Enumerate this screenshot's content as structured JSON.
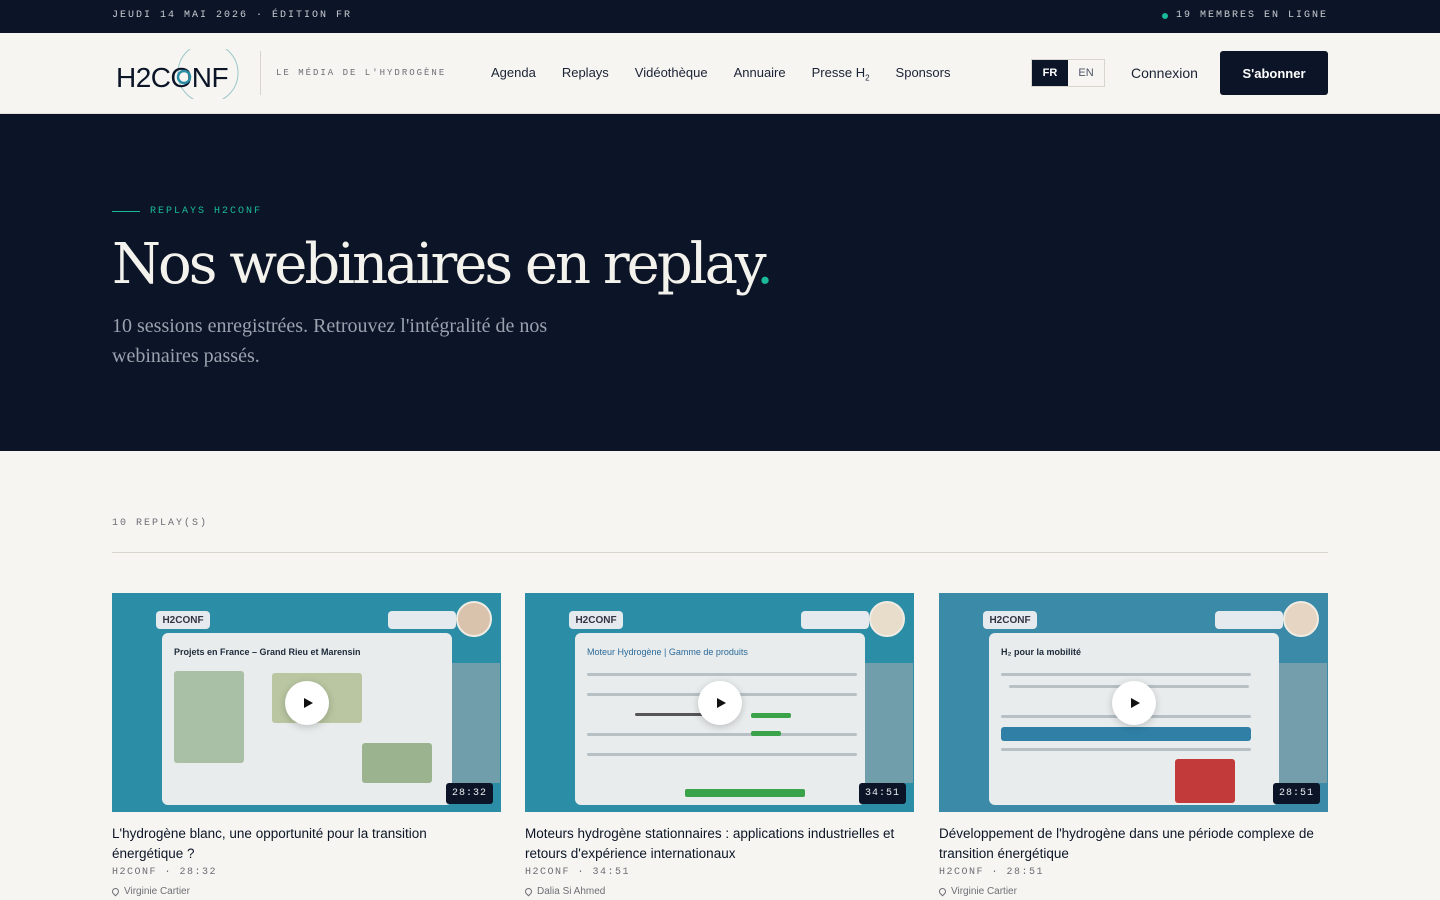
{
  "topbar": {
    "date_edition": "JEUDI 14 MAI 2026 · ÉDITION FR",
    "online": "19 MEMBRES EN LIGNE"
  },
  "header": {
    "logo_text": "H2CONF",
    "tagline": "LE MÉDIA DE L'HYDROGÈNE",
    "nav": [
      {
        "label": "Agenda"
      },
      {
        "label": "Replays"
      },
      {
        "label": "Vidéothèque"
      },
      {
        "label": "Annuaire"
      },
      {
        "label": "Presse H",
        "sub": "2"
      },
      {
        "label": "Sponsors"
      }
    ],
    "lang_fr": "FR",
    "lang_en": "EN",
    "login": "Connexion",
    "subscribe": "S'abonner"
  },
  "hero": {
    "eyebrow": "REPLAYS H2CONF",
    "title": "Nos webinaires en replay",
    "title_dot": ".",
    "subtitle": "10 sessions enregistrées. Retrouvez l'intégralité de nos webinaires passés."
  },
  "list": {
    "count": "10 REPLAY(S)",
    "cards": [
      {
        "thumb_title": "Projets en France – Grand Rieu et Marensin",
        "duration": "28:32",
        "title": "L'hydrogène blanc, une opportunité pour la transition énergétique ?",
        "meta": "H2CONF · 28:32",
        "speaker": "Virginie Cartier"
      },
      {
        "thumb_title": "Moteur Hydrogène | Gamme de produits",
        "duration": "34:51",
        "title": "Moteurs hydrogène stationnaires : applications industrielles et retours d'expérience internationaux",
        "meta": "H2CONF · 34:51",
        "speaker": "Dalia Si Ahmed"
      },
      {
        "thumb_title": "H₂ pour la mobilité",
        "duration": "28:51",
        "title": "Développement de l'hydrogène dans une période complexe de transition énergétique",
        "meta": "H2CONF · 28:51",
        "speaker": "Virginie Cartier"
      }
    ]
  },
  "colors": {
    "navy": "#0c1527",
    "accent": "#19b99a",
    "thumb_bg": "#2b8ea6",
    "page_bg": "#f6f5f1"
  }
}
